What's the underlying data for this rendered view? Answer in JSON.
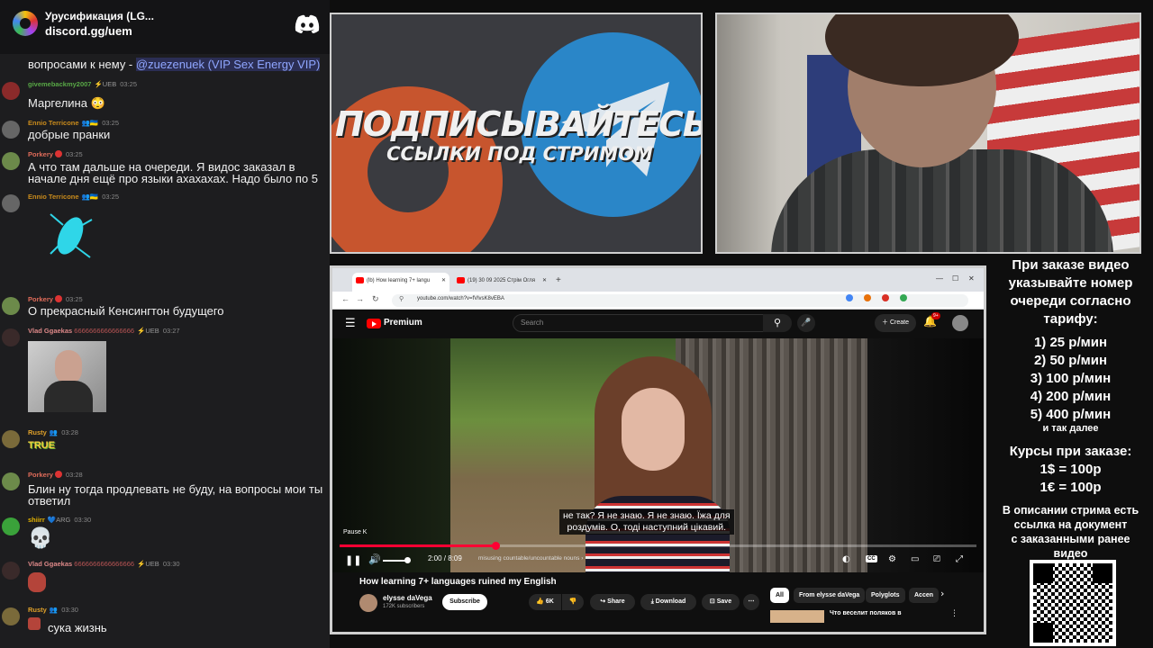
{
  "chat": {
    "server_name": "Урусификация (LG...",
    "server_link": "discord.gg/uem",
    "messages": [
      {
        "text": "вопросами к нему - ",
        "mention": "@zuezenuek (VIP Sex Energy VIP)"
      },
      {
        "user": "givemebackmy2007",
        "badge": "⚡UEB",
        "time": "03:25",
        "text": "Маргелина 😳"
      },
      {
        "user": "Ennio Terricone",
        "badge": "👥🇺🇦",
        "time": "03:25",
        "text": "добрые пранки"
      },
      {
        "user": "Porkery",
        "time": "03:25",
        "text": "А что там дальше на очереди. Я видос заказал в начале дня ещё про языки ахахахах. Надо было по 5"
      },
      {
        "user": "Ennio Terricone",
        "badge": "👥🇺🇦",
        "time": "03:25",
        "sticker": "cockroach"
      },
      {
        "user": "Porkery",
        "time": "03:25",
        "text": "О прекрасный Кенсингтон будущего"
      },
      {
        "user": "Vlad Ggaekas",
        "user_suffix": "6666666666666666",
        "badge": "⚡UEB",
        "time": "03:27",
        "image": "photo"
      },
      {
        "user": "Rusty",
        "badge": "👥",
        "time": "03:28",
        "sticker": "TRUE"
      },
      {
        "user": "Porkery",
        "time": "03:28",
        "text": "Блин ну тогда продлевать не буду, на вопросы мои ты ответил"
      },
      {
        "user": "shiirr",
        "badge": "💙ARG",
        "time": "03:30",
        "sticker": "skull"
      },
      {
        "user": "Vlad Ggaekas",
        "user_suffix": "6666666666666666",
        "badge": "⚡UEB",
        "time": "03:30",
        "sticker": "face"
      },
      {
        "user": "Rusty",
        "badge": "👥",
        "time": "03:30",
        "text": "сука жизнь"
      }
    ]
  },
  "promo": {
    "title": "ПОДПИСЫВАЙТЕСЬ",
    "subtitle": "ССЫЛКИ ПОД СТРИМОМ"
  },
  "browser": {
    "tabs": [
      {
        "label": "(lb) How learning 7+ langu"
      },
      {
        "label": "(19) 30 09 2025 Стрім Огля"
      }
    ],
    "url": "youtube.com/watch?v=fVlvsK8vEBA"
  },
  "youtube": {
    "brand": "Premium",
    "search_placeholder": "Search",
    "create_label": "Create",
    "notif_count": "9+",
    "subtitles": "не так?  Я не знаю.  Я не знаю.  Їжа для\nроздумів.  О, тоді наступний цікавий.",
    "pause_tooltip": "Pause  K",
    "time": "2:00 / 8:09",
    "chapter": "misusing countable/uncountable nouns  ›",
    "progress": 0.245,
    "video_title": "How learning 7+ languages ruined my English",
    "channel_name": "elysse daVega",
    "channel_subs": "172K subscribers",
    "subscribe_label": "Subscribe",
    "likes": "6K",
    "share_label": "Share",
    "download_label": "Download",
    "save_label": "Save",
    "chips": [
      "All",
      "From elysse daVega",
      "Polyglots",
      "Accen"
    ],
    "rec_title": "Что веселит поляков в"
  },
  "info": {
    "order_text": "При заказе видео\nуказывайте номер\nочереди согласно\nтарифу:",
    "prices": [
      "1) 25 р/мин",
      "2) 50 р/мин",
      "3) 100 р/мин",
      "4) 200 р/мин",
      "5) 400 р/мин"
    ],
    "etc": "и так далее",
    "rates": "Курсы при заказе:\n1$ = 100р\n1€ = 100р",
    "desc": "В описании стрима есть\nссылка на документ\nс заказанными ранее\nвидео"
  }
}
